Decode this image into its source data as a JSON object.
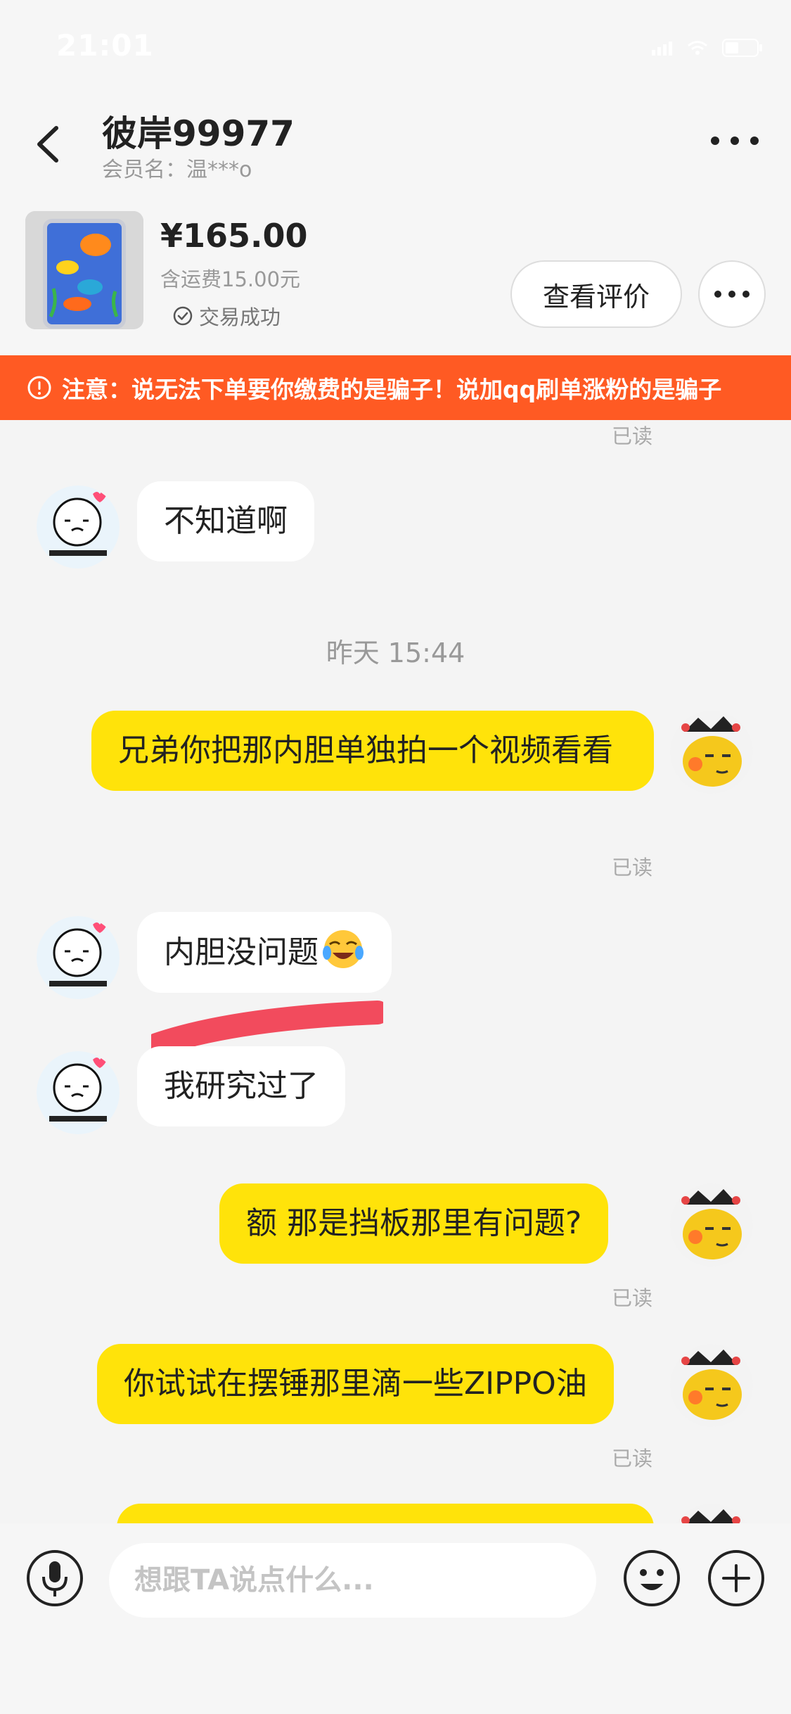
{
  "status_bar": {
    "time": "21:01"
  },
  "header": {
    "title": "彼岸99977",
    "subtitle": "会员名：温***o"
  },
  "order": {
    "price": "¥165.00",
    "shipping": "含运费15.00元",
    "status": "交易成功",
    "review_label": "查看评价"
  },
  "warning": {
    "text": "注意：说无法下单要你缴费的是骗子！说加qq刷单涨粉的是骗子"
  },
  "chat": {
    "read_label": "已读",
    "timestamp": "昨天 15:44",
    "messages": [
      {
        "text": "不知道啊"
      },
      {
        "text": "兄弟你把那内胆单独拍一个视频看看"
      },
      {
        "text": "内胆没问题"
      },
      {
        "text": "我研究过了"
      },
      {
        "text": "额 那是挡板那里有问题?"
      },
      {
        "text": "你试试在摆锤那里滴一些ZIPPO油"
      }
    ]
  },
  "input": {
    "placeholder": "想跟TA说点什么..."
  },
  "icons": {
    "back": "chevron-left-icon",
    "more": "more-dots-icon",
    "verified": "check-circle-icon",
    "warning": "alert-circle-icon",
    "mic": "microphone-icon",
    "emoji": "emoji-icon",
    "plus": "plus-icon"
  },
  "colors": {
    "accent_yellow": "#ffe30a",
    "warning_orange": "#ff5a23"
  }
}
